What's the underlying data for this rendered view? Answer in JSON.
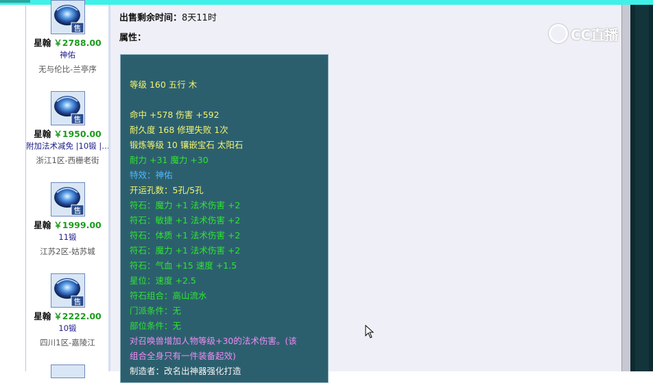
{
  "top_tag": "",
  "sale_time": {
    "label": "出售剩余时间：",
    "value": "8天11时"
  },
  "attr_label": "属性：",
  "listings": [
    {
      "sell_badge": "售",
      "title": "星翰",
      "price": "￥2788.00",
      "tag": "神佑",
      "server": "无与伦比-兰亭序"
    },
    {
      "sell_badge": "售",
      "title": "星翰",
      "price": "￥1950.00",
      "tag": "附加法术减免 |10锻 |…",
      "server": "浙江1区-西栅老街"
    },
    {
      "sell_badge": "售",
      "title": "星翰",
      "price": "￥1999.00",
      "tag": "11锻",
      "server": "江苏2区-姑苏城"
    },
    {
      "sell_badge": "售",
      "title": "星翰",
      "price": "￥2222.00",
      "tag": "10锻",
      "server": "四川1区-嘉陵江"
    }
  ],
  "attributes": [
    {
      "text": "等级 160 五行 木",
      "color": "yellow"
    },
    {
      "text": "命中 +578 伤害 +592",
      "color": "yellow"
    },
    {
      "text": "耐久度 168 修理失败 1次",
      "color": "yellow"
    },
    {
      "text": "锻炼等级 10 镶嵌宝石 太阳石",
      "color": "yellow"
    },
    {
      "text": "耐力 +31 魔力 +30",
      "color": "green"
    },
    {
      "text": "特效：神佑",
      "color": "blue"
    },
    {
      "text": "开运孔数：5孔/5孔",
      "color": "yellow"
    },
    {
      "text": "符石：魔力 +1 法术伤害 +2",
      "color": "green"
    },
    {
      "text": "符石：敏捷 +1 法术伤害 +2",
      "color": "green"
    },
    {
      "text": "符石：体质 +1 法术伤害 +2",
      "color": "green"
    },
    {
      "text": "符石：魔力 +1 法术伤害 +2",
      "color": "green"
    },
    {
      "text": "符石：气血 +15 速度 +1.5",
      "color": "green"
    },
    {
      "text": "星位：速度 +2.5",
      "color": "green"
    },
    {
      "text": "符石组合：高山流水",
      "color": "green"
    },
    {
      "text": "门派条件：无",
      "color": "green"
    },
    {
      "text": "部位条件：无",
      "color": "green"
    },
    {
      "text": "对召唤兽增加人物等级+30的法术伤害。(该",
      "color": "pink"
    },
    {
      "text": "组合全身只有一件装备起效)",
      "color": "pink"
    },
    {
      "text": "制造者：改名出神器强化打造",
      "color": "white"
    }
  ],
  "watermark": "CC直播",
  "colors": {
    "box_bg": "#2c5f6e",
    "yellow": "#f3f56e",
    "green": "#2fe52f",
    "blue": "#50b7ff",
    "pink": "#ee8cf4",
    "price": "#1d9b1d"
  }
}
